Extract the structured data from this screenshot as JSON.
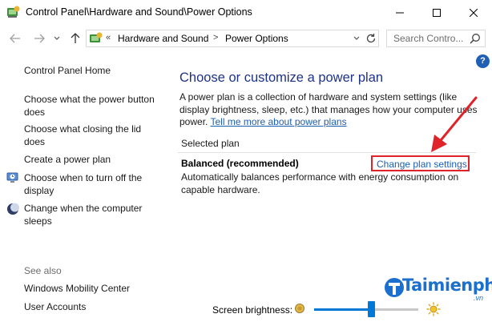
{
  "window": {
    "title": "Control Panel\\Hardware and Sound\\Power Options",
    "icon": "control-panel-icon"
  },
  "address_bar": {
    "separator": "«",
    "breadcrumbs": [
      "Hardware and Sound",
      "Power Options"
    ],
    "crumb_separator": ">"
  },
  "search": {
    "placeholder": "Search Contro..."
  },
  "sidebar": {
    "home_label": "Control Panel Home",
    "items": [
      {
        "label": "Choose what the power button does",
        "icon": null
      },
      {
        "label": "Choose what closing the lid does",
        "icon": null
      },
      {
        "label": "Create a power plan",
        "icon": null
      },
      {
        "label": "Choose when to turn off the display",
        "icon": "monitor-shield-icon"
      },
      {
        "label": "Change when the computer sleeps",
        "icon": "moon-icon"
      }
    ],
    "see_also_heading": "See also",
    "see_also_items": [
      "Windows Mobility Center",
      "User Accounts"
    ]
  },
  "main": {
    "title": "Choose or customize a power plan",
    "description": "A power plan is a collection of hardware and system settings (like display brightness, sleep, etc.) that manages how your computer uses power.",
    "learn_more_link": "Tell me more about power plans",
    "section_label": "Selected plan",
    "plan_name": "Balanced (recommended)",
    "change_plan_link": "Change plan settings",
    "plan_description": "Automatically balances performance with energy consumption on capable hardware.",
    "help_label": "?"
  },
  "bottom": {
    "brightness_label": "Screen brightness:",
    "brightness_level_percent": 55
  },
  "watermark": {
    "brand": "Taimienphi",
    "suffix": ".vn"
  },
  "colors": {
    "title_blue": "#1e3287",
    "link_blue": "#1c5fb0",
    "highlight_red": "#e0232a",
    "slider_blue": "#0078d7"
  }
}
